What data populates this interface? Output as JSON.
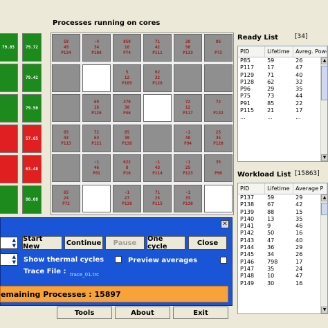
{
  "grid": {
    "title": "Processes running on cores",
    "cores": [
      {
        "state": "busy",
        "lines": [
          "59",
          "49",
          "P134"
        ]
      },
      {
        "state": "busy",
        "lines": [
          "-4",
          "34",
          "P108"
        ]
      },
      {
        "state": "busy",
        "lines": [
          "858",
          "16",
          "P74"
        ]
      },
      {
        "state": "busy",
        "lines": [
          "71",
          "42",
          "P111"
        ]
      },
      {
        "state": "busy",
        "lines": [
          "28",
          "90",
          "P133"
        ]
      },
      {
        "state": "busy",
        "lines": [
          "86",
          "",
          "P73"
        ]
      },
      {
        "state": "busy",
        "lines": []
      },
      {
        "state": "idle",
        "lines": []
      },
      {
        "state": "busy",
        "lines": [
          "5",
          "12",
          "P105"
        ]
      },
      {
        "state": "busy",
        "lines": [
          "62",
          "32",
          "P128"
        ]
      },
      {
        "state": "busy",
        "lines": []
      },
      {
        "state": "busy",
        "lines": []
      },
      {
        "state": "busy",
        "lines": []
      },
      {
        "state": "busy",
        "lines": [
          "69",
          "16",
          "P126"
        ]
      },
      {
        "state": "busy",
        "lines": [
          "370",
          "30",
          "P46"
        ]
      },
      {
        "state": "idle",
        "lines": []
      },
      {
        "state": "busy",
        "lines": [
          "72",
          "12",
          "P117"
        ]
      },
      {
        "state": "busy",
        "lines": [
          "72",
          "",
          "P132"
        ]
      },
      {
        "state": "busy",
        "lines": [
          "65",
          "43",
          "P113"
        ]
      },
      {
        "state": "busy",
        "lines": [
          "72",
          "63",
          "P121"
        ]
      },
      {
        "state": "busy",
        "lines": [
          "65",
          "38",
          "P138"
        ]
      },
      {
        "state": "busy",
        "lines": []
      },
      {
        "state": "busy",
        "lines": [
          "-1",
          "48",
          "P94"
        ]
      },
      {
        "state": "busy",
        "lines": [
          "25",
          "35",
          "P120"
        ]
      },
      {
        "state": "busy",
        "lines": []
      },
      {
        "state": "busy",
        "lines": [
          "-1",
          "46",
          "P81"
        ]
      },
      {
        "state": "busy",
        "lines": [
          "622",
          "8",
          "P16"
        ]
      },
      {
        "state": "busy",
        "lines": [
          "-1",
          "43",
          "P114"
        ]
      },
      {
        "state": "busy",
        "lines": [
          "-1",
          "25",
          "P123"
        ]
      },
      {
        "state": "busy",
        "lines": [
          "35",
          "",
          "P90"
        ]
      },
      {
        "state": "busy",
        "lines": [
          "65",
          "24",
          "P72"
        ]
      },
      {
        "state": "idle",
        "lines": []
      },
      {
        "state": "busy",
        "lines": [
          "-1",
          "27",
          "P136"
        ]
      },
      {
        "state": "busy",
        "lines": [
          "71",
          "25",
          "P115"
        ]
      },
      {
        "state": "busy",
        "lines": [
          "-1",
          "33",
          "P130"
        ]
      },
      {
        "state": "idle",
        "lines": []
      }
    ]
  },
  "temps": {
    "col1": [
      {
        "text": "79.85",
        "color": "#1d8a1d"
      },
      {
        "text": "",
        "color": "#1d8a1d"
      },
      {
        "text": "",
        "color": "#1d8a1d"
      },
      {
        "text": "",
        "color": "#e02020"
      },
      {
        "text": "",
        "color": "#e02020"
      },
      {
        "text": "",
        "color": "#1d8a1d"
      }
    ],
    "col2": [
      {
        "text": "79.72",
        "color": "#1d8a1d"
      },
      {
        "text": "79.42",
        "color": "#1d8a1d"
      },
      {
        "text": "79.50",
        "color": "#1d8a1d"
      },
      {
        "text": "57.65",
        "color": "#e02020"
      },
      {
        "text": "63.48",
        "color": "#e02020"
      },
      {
        "text": "80.08",
        "color": "#1d8a1d"
      }
    ]
  },
  "ready_list": {
    "title": "Ready List",
    "count": "[34]",
    "headers": [
      "PID",
      "Lifetime",
      "Avreg. Powe"
    ],
    "rows": [
      [
        "P85",
        "59",
        "26"
      ],
      [
        "P117",
        "17",
        "47"
      ],
      [
        "P129",
        "71",
        "40"
      ],
      [
        "P128",
        "62",
        "32"
      ],
      [
        "P96",
        "29",
        "35"
      ],
      [
        "P75",
        "73",
        "44"
      ],
      [
        "P91",
        "85",
        "22"
      ],
      [
        "P115",
        "21",
        "17"
      ],
      [
        "...",
        "...",
        "..."
      ]
    ]
  },
  "workload_list": {
    "title": "Workload List",
    "count": "[15863]",
    "headers": [
      "PID",
      "Lifetime",
      "Average P"
    ],
    "rows": [
      [
        "P137",
        "59",
        "29"
      ],
      [
        "P138",
        "67",
        "42"
      ],
      [
        "P139",
        "88",
        "15"
      ],
      [
        "P140",
        "13",
        "35"
      ],
      [
        "P141",
        "9",
        "46"
      ],
      [
        "P142",
        "50",
        "16"
      ],
      [
        "P143",
        "47",
        "40"
      ],
      [
        "P144",
        "36",
        "29"
      ],
      [
        "P145",
        "34",
        "26"
      ],
      [
        "P146",
        "798",
        "17"
      ],
      [
        "P147",
        "35",
        "24"
      ],
      [
        "P148",
        "10",
        "47"
      ],
      [
        "P149",
        "30",
        "16"
      ]
    ]
  },
  "controls": {
    "close_glyph": "✕",
    "start_new": "Start New",
    "continue": "Continue",
    "pause": "Pause",
    "one_cycle": "One cycle",
    "close": "Close",
    "show_thermal": "Show thermal cycles",
    "preview_averages": "Preview averages",
    "trace_label": "Trace File :",
    "trace_file": "trace_01.trc",
    "remaining": "emaining Processes : 15897"
  },
  "footer": {
    "tools": "Tools",
    "about": "About",
    "exit": "Exit"
  },
  "colors": {
    "panel": "#1a55d8",
    "remaining_bar": "#f7a33a",
    "core_busy": "#8f8f8f",
    "core_idle": "#ffffff",
    "core_text": "#9b1b1b"
  }
}
